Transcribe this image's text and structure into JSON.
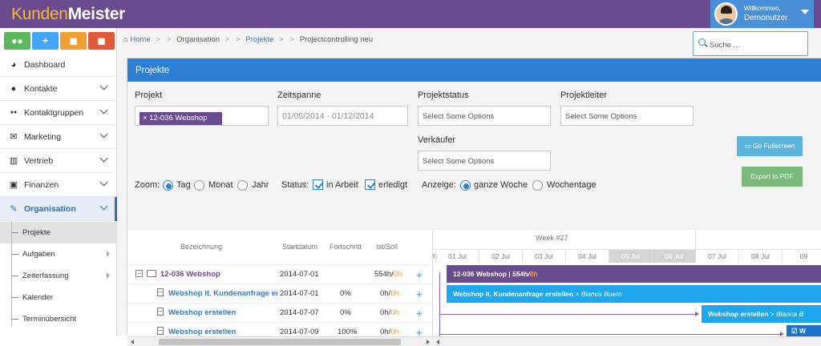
{
  "app": {
    "logo_part1": "Kunden",
    "logo_part2": "Meister"
  },
  "user": {
    "welcome": "Willkommen,",
    "name": "Demonutzer"
  },
  "quick_buttons": [
    {
      "icon": "users-icon",
      "glyph": "👥",
      "color": "#5cb85c"
    },
    {
      "icon": "plus-icon",
      "glyph": "+",
      "color": "#42a5f5"
    },
    {
      "icon": "briefcase-icon",
      "glyph": "◼",
      "color": "#f0a030"
    },
    {
      "icon": "toolbox-icon",
      "glyph": "◼",
      "color": "#e05a3a"
    }
  ],
  "sidebar": {
    "items": [
      {
        "label": "Dashboard",
        "icon": "dashboard-icon",
        "glyph": "◕"
      },
      {
        "label": "Kontakte",
        "icon": "user-icon",
        "glyph": "●"
      },
      {
        "label": "Kontaktgruppen",
        "icon": "group-icon",
        "glyph": "●●"
      },
      {
        "label": "Marketing",
        "icon": "envelope-icon",
        "glyph": "✉"
      },
      {
        "label": "Vertrieb",
        "icon": "chart-icon",
        "glyph": "▥"
      },
      {
        "label": "Finanzen",
        "icon": "money-icon",
        "glyph": "▣"
      },
      {
        "label": "Organisation",
        "icon": "edit-icon",
        "glyph": "✎"
      }
    ],
    "subitems": [
      {
        "label": "Projekte"
      },
      {
        "label": "Aufgaben"
      },
      {
        "label": "Zeiterfassung"
      },
      {
        "label": "Kalender"
      },
      {
        "label": "Terminübersicht"
      }
    ]
  },
  "breadcrumb": {
    "home": "Home",
    "level1": "Organisation",
    "level2": "Projekte",
    "level3": "Projectcontrolling neu",
    "sep": ">"
  },
  "search": {
    "placeholder": "Suche ..."
  },
  "panel": {
    "title": "Projekte"
  },
  "form": {
    "projekt_label": "Projekt",
    "projekt_tag": "× 12-036 Webshop",
    "zeitspanne_label": "Zeitspanne",
    "zeitspanne_value": "01/05/2014 - 01/12/2014",
    "projektstatus_label": "Projektstatus",
    "projektstatus_placeholder": "Select Some Options",
    "projektleiter_label": "Projektleiter",
    "projektleiter_placeholder": "Select Some Options",
    "verkaeufer_label": "Verkäufer",
    "verkaeufer_placeholder": "Select Some Options",
    "go_fullscreen": "Go Fullscreen",
    "export_pdf": "Export to PDF",
    "zoom_label": "Zoom:",
    "zoom_tag": "Tag",
    "zoom_monat": "Monat",
    "zoom_jahr": "Jahr",
    "status_label": "Status:",
    "status_arbeit": "in Arbeit",
    "status_erledigt": "erledigt",
    "anzeige_label": "Anzeige:",
    "anzeige_ganze": "ganze Woche",
    "anzeige_wochentage": "Wochentage"
  },
  "gantt": {
    "headers": {
      "bezeichnung": "Bezeichnung",
      "startdatum": "Startdatum",
      "fortschritt": "Fortschritt",
      "istsoll": "Ist/Soll"
    },
    "week": "Week #27",
    "day_prefix": "h",
    "days": [
      "01 Jul",
      "02 Jul",
      "03 Jul",
      "04 Jul",
      "05 Jul",
      "06 Jul",
      "07 Jul",
      "08 Jul",
      "09"
    ],
    "rows": [
      {
        "name": "12-036 Webshop",
        "start": "2014-07-01",
        "progress": "",
        "ist": "554h/",
        "soll": "0h"
      },
      {
        "name": "Webshop lt. Kundenanfrage erstellen",
        "start": "2014-07-01",
        "progress": "0%",
        "ist": "0h/",
        "soll": "0h"
      },
      {
        "name": "Webshop erstellen",
        "start": "2014-07-07",
        "progress": "0%",
        "ist": "0h/",
        "soll": "0h"
      },
      {
        "name": "Webshop erstellen",
        "start": "2014-07-09",
        "progress": "100%",
        "ist": "0h/",
        "soll": "0h"
      }
    ],
    "bars": [
      {
        "label": "12-036 Webshop | ",
        "italic": "554h/",
        "accent": "0h",
        "color": "#6b4b8f"
      },
      {
        "label": "Webshop lt. Kundenanfrage erstellen ",
        "italic": "> Bianca Buero",
        "accent": "",
        "color": "#1ea7ec"
      },
      {
        "label": "Webshop erstellen ",
        "italic": "> Bianca B",
        "accent": "",
        "color": "#1ea7ec"
      },
      {
        "label": "W",
        "italic": "",
        "accent": "",
        "color": "#1a73c8"
      }
    ]
  },
  "colors": {
    "primary": "#2e7fd6",
    "brand": "#6b4b8f",
    "soll": "#f0a030"
  }
}
